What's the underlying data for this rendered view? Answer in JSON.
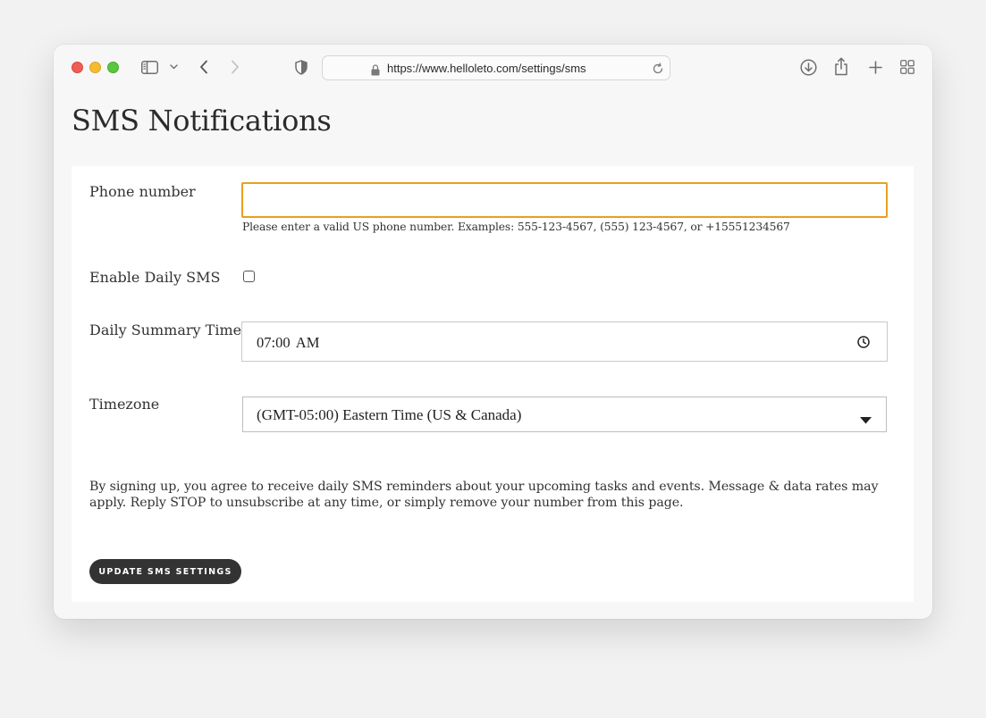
{
  "browser": {
    "url": "https://www.helloleto.com/settings/sms"
  },
  "page": {
    "title": "SMS Notifications"
  },
  "form": {
    "phone": {
      "label": "Phone number",
      "value": "",
      "hint": "Please enter a valid US phone number. Examples: 555-123-4567, (555) 123-4567, or +15551234567"
    },
    "daily_sms": {
      "label": "Enable Daily SMS",
      "checked": false
    },
    "summary_time": {
      "label": "Daily Summary Time",
      "value": "07:00 AM"
    },
    "timezone": {
      "label": "Timezone",
      "selected": "(GMT-05:00) Eastern Time (US & Canada)"
    },
    "disclaimer": "By signing up, you agree to receive daily SMS reminders about your upcoming tasks and events. Message & data rates may apply. Reply STOP to unsubscribe at any time, or simply remove your number from this page.",
    "submit_label": "UPDATE SMS SETTINGS"
  },
  "colors": {
    "focus_border": "#e8a020",
    "button_bg": "#333333",
    "close": "#ee5d56",
    "minimize": "#f5bd2e",
    "maximize": "#5ac53f"
  },
  "icons": [
    "sidebar-icon",
    "chevron-down-icon",
    "back-icon",
    "forward-icon",
    "shield-icon",
    "lock-icon",
    "reload-icon",
    "download-icon",
    "share-icon",
    "plus-icon",
    "tabs-grid-icon",
    "clock-icon",
    "dropdown-caret-icon"
  ]
}
